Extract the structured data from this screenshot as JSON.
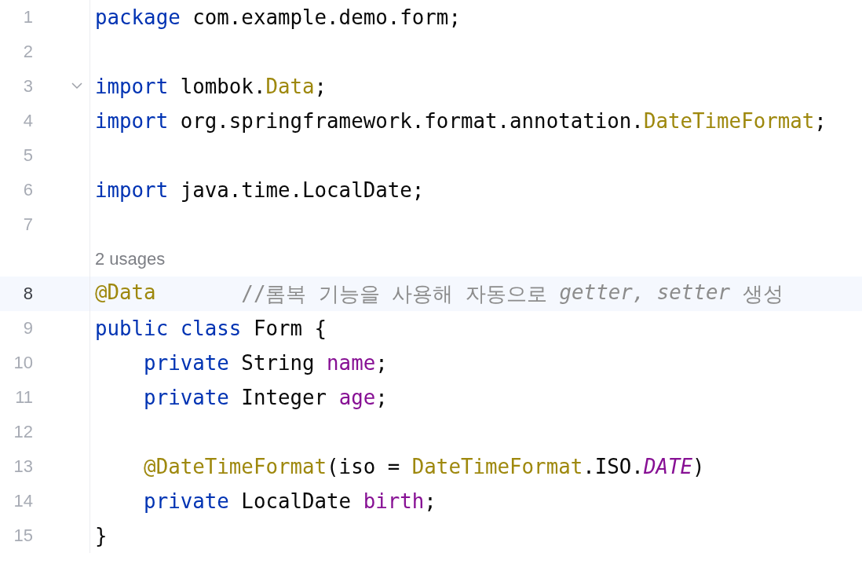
{
  "editor": {
    "lines": [
      {
        "number": "1",
        "current": false,
        "foldable": false,
        "tokens": [
          {
            "kind": "keyword",
            "text": "package"
          },
          {
            "kind": "plain",
            "text": " com.example.demo.form;"
          }
        ]
      },
      {
        "number": "2",
        "current": false,
        "foldable": false
      },
      {
        "number": "3",
        "current": false,
        "foldable": true,
        "tokens": [
          {
            "kind": "keyword",
            "text": "import"
          },
          {
            "kind": "plain",
            "text": " lombok."
          },
          {
            "kind": "annotation",
            "text": "Data"
          },
          {
            "kind": "plain",
            "text": ";"
          }
        ]
      },
      {
        "number": "4",
        "current": false,
        "foldable": false,
        "tokens": [
          {
            "kind": "keyword",
            "text": "import"
          },
          {
            "kind": "plain",
            "text": " org.springframework.format.annotation."
          },
          {
            "kind": "annotation",
            "text": "DateTimeFormat"
          },
          {
            "kind": "plain",
            "text": ";"
          }
        ]
      },
      {
        "number": "5",
        "current": false,
        "foldable": false
      },
      {
        "number": "6",
        "current": false,
        "foldable": false,
        "tokens": [
          {
            "kind": "keyword",
            "text": "import"
          },
          {
            "kind": "plain",
            "text": " java.time.LocalDate;"
          }
        ]
      },
      {
        "number": "7",
        "current": false,
        "foldable": false
      },
      {
        "number": "8",
        "current": true,
        "foldable": false,
        "hint": "2 usages",
        "tokens": [
          {
            "kind": "annotation",
            "text": "@Data"
          },
          {
            "kind": "comment",
            "text": "       //롬복 기능을 사용해 자동으로 "
          },
          {
            "kind": "comment_italic",
            "text": "getter, setter"
          },
          {
            "kind": "comment",
            "text": " 생성"
          }
        ]
      },
      {
        "number": "9",
        "current": false,
        "foldable": false,
        "tokens": [
          {
            "kind": "keyword",
            "text": "public class"
          },
          {
            "kind": "plain",
            "text": " Form {"
          }
        ]
      },
      {
        "number": "10",
        "current": false,
        "foldable": false,
        "tokens": [
          {
            "kind": "keyword",
            "text": "    private"
          },
          {
            "kind": "plain",
            "text": " String "
          },
          {
            "kind": "field",
            "text": "name"
          },
          {
            "kind": "plain",
            "text": ";"
          }
        ]
      },
      {
        "number": "11",
        "current": false,
        "foldable": false,
        "tokens": [
          {
            "kind": "keyword",
            "text": "    private"
          },
          {
            "kind": "plain",
            "text": " Integer "
          },
          {
            "kind": "field",
            "text": "age"
          },
          {
            "kind": "plain",
            "text": ";"
          }
        ]
      },
      {
        "number": "12",
        "current": false,
        "foldable": false
      },
      {
        "number": "13",
        "current": false,
        "foldable": false,
        "tokens": [
          {
            "kind": "annotation",
            "text": "    @DateTimeFormat"
          },
          {
            "kind": "plain",
            "text": "(iso = "
          },
          {
            "kind": "annotation",
            "text": "DateTimeFormat"
          },
          {
            "kind": "plain",
            "text": ".ISO."
          },
          {
            "kind": "static_field",
            "text": "DATE"
          },
          {
            "kind": "plain",
            "text": ")"
          }
        ]
      },
      {
        "number": "14",
        "current": false,
        "foldable": false,
        "tokens": [
          {
            "kind": "keyword",
            "text": "    private"
          },
          {
            "kind": "plain",
            "text": " LocalDate "
          },
          {
            "kind": "field",
            "text": "birth"
          },
          {
            "kind": "plain",
            "text": ";"
          }
        ]
      },
      {
        "number": "15",
        "current": false,
        "foldable": false,
        "tokens": [
          {
            "kind": "plain",
            "text": "}"
          }
        ]
      }
    ]
  }
}
